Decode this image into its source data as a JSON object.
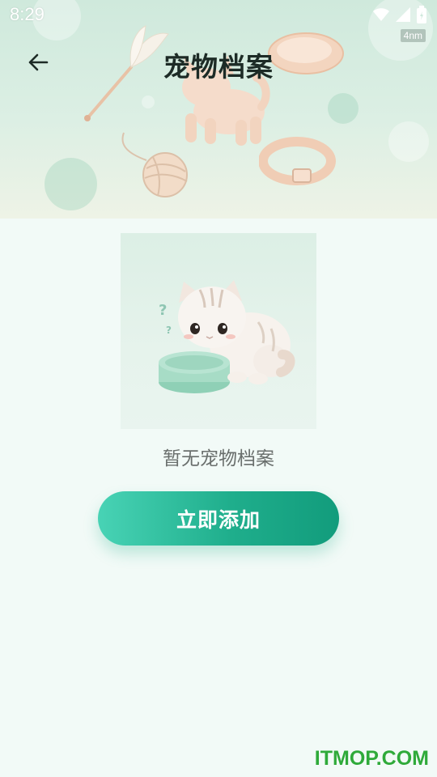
{
  "status_bar": {
    "time": "8:29",
    "icons": [
      "wifi-icon",
      "signal-icon",
      "battery-icon"
    ],
    "badge": "4nm"
  },
  "header": {
    "back_icon": "arrow-left-icon",
    "title": "宠物档案"
  },
  "empty_state": {
    "message": "暂无宠物档案",
    "button_label": "立即添加"
  },
  "watermark": "ITMOP.COM",
  "colors": {
    "page_background": "#f2faf7",
    "button_start": "#48d3b5",
    "button_end": "#129c7c",
    "title": "#1d2b26",
    "watermark": "#2faa3a"
  }
}
